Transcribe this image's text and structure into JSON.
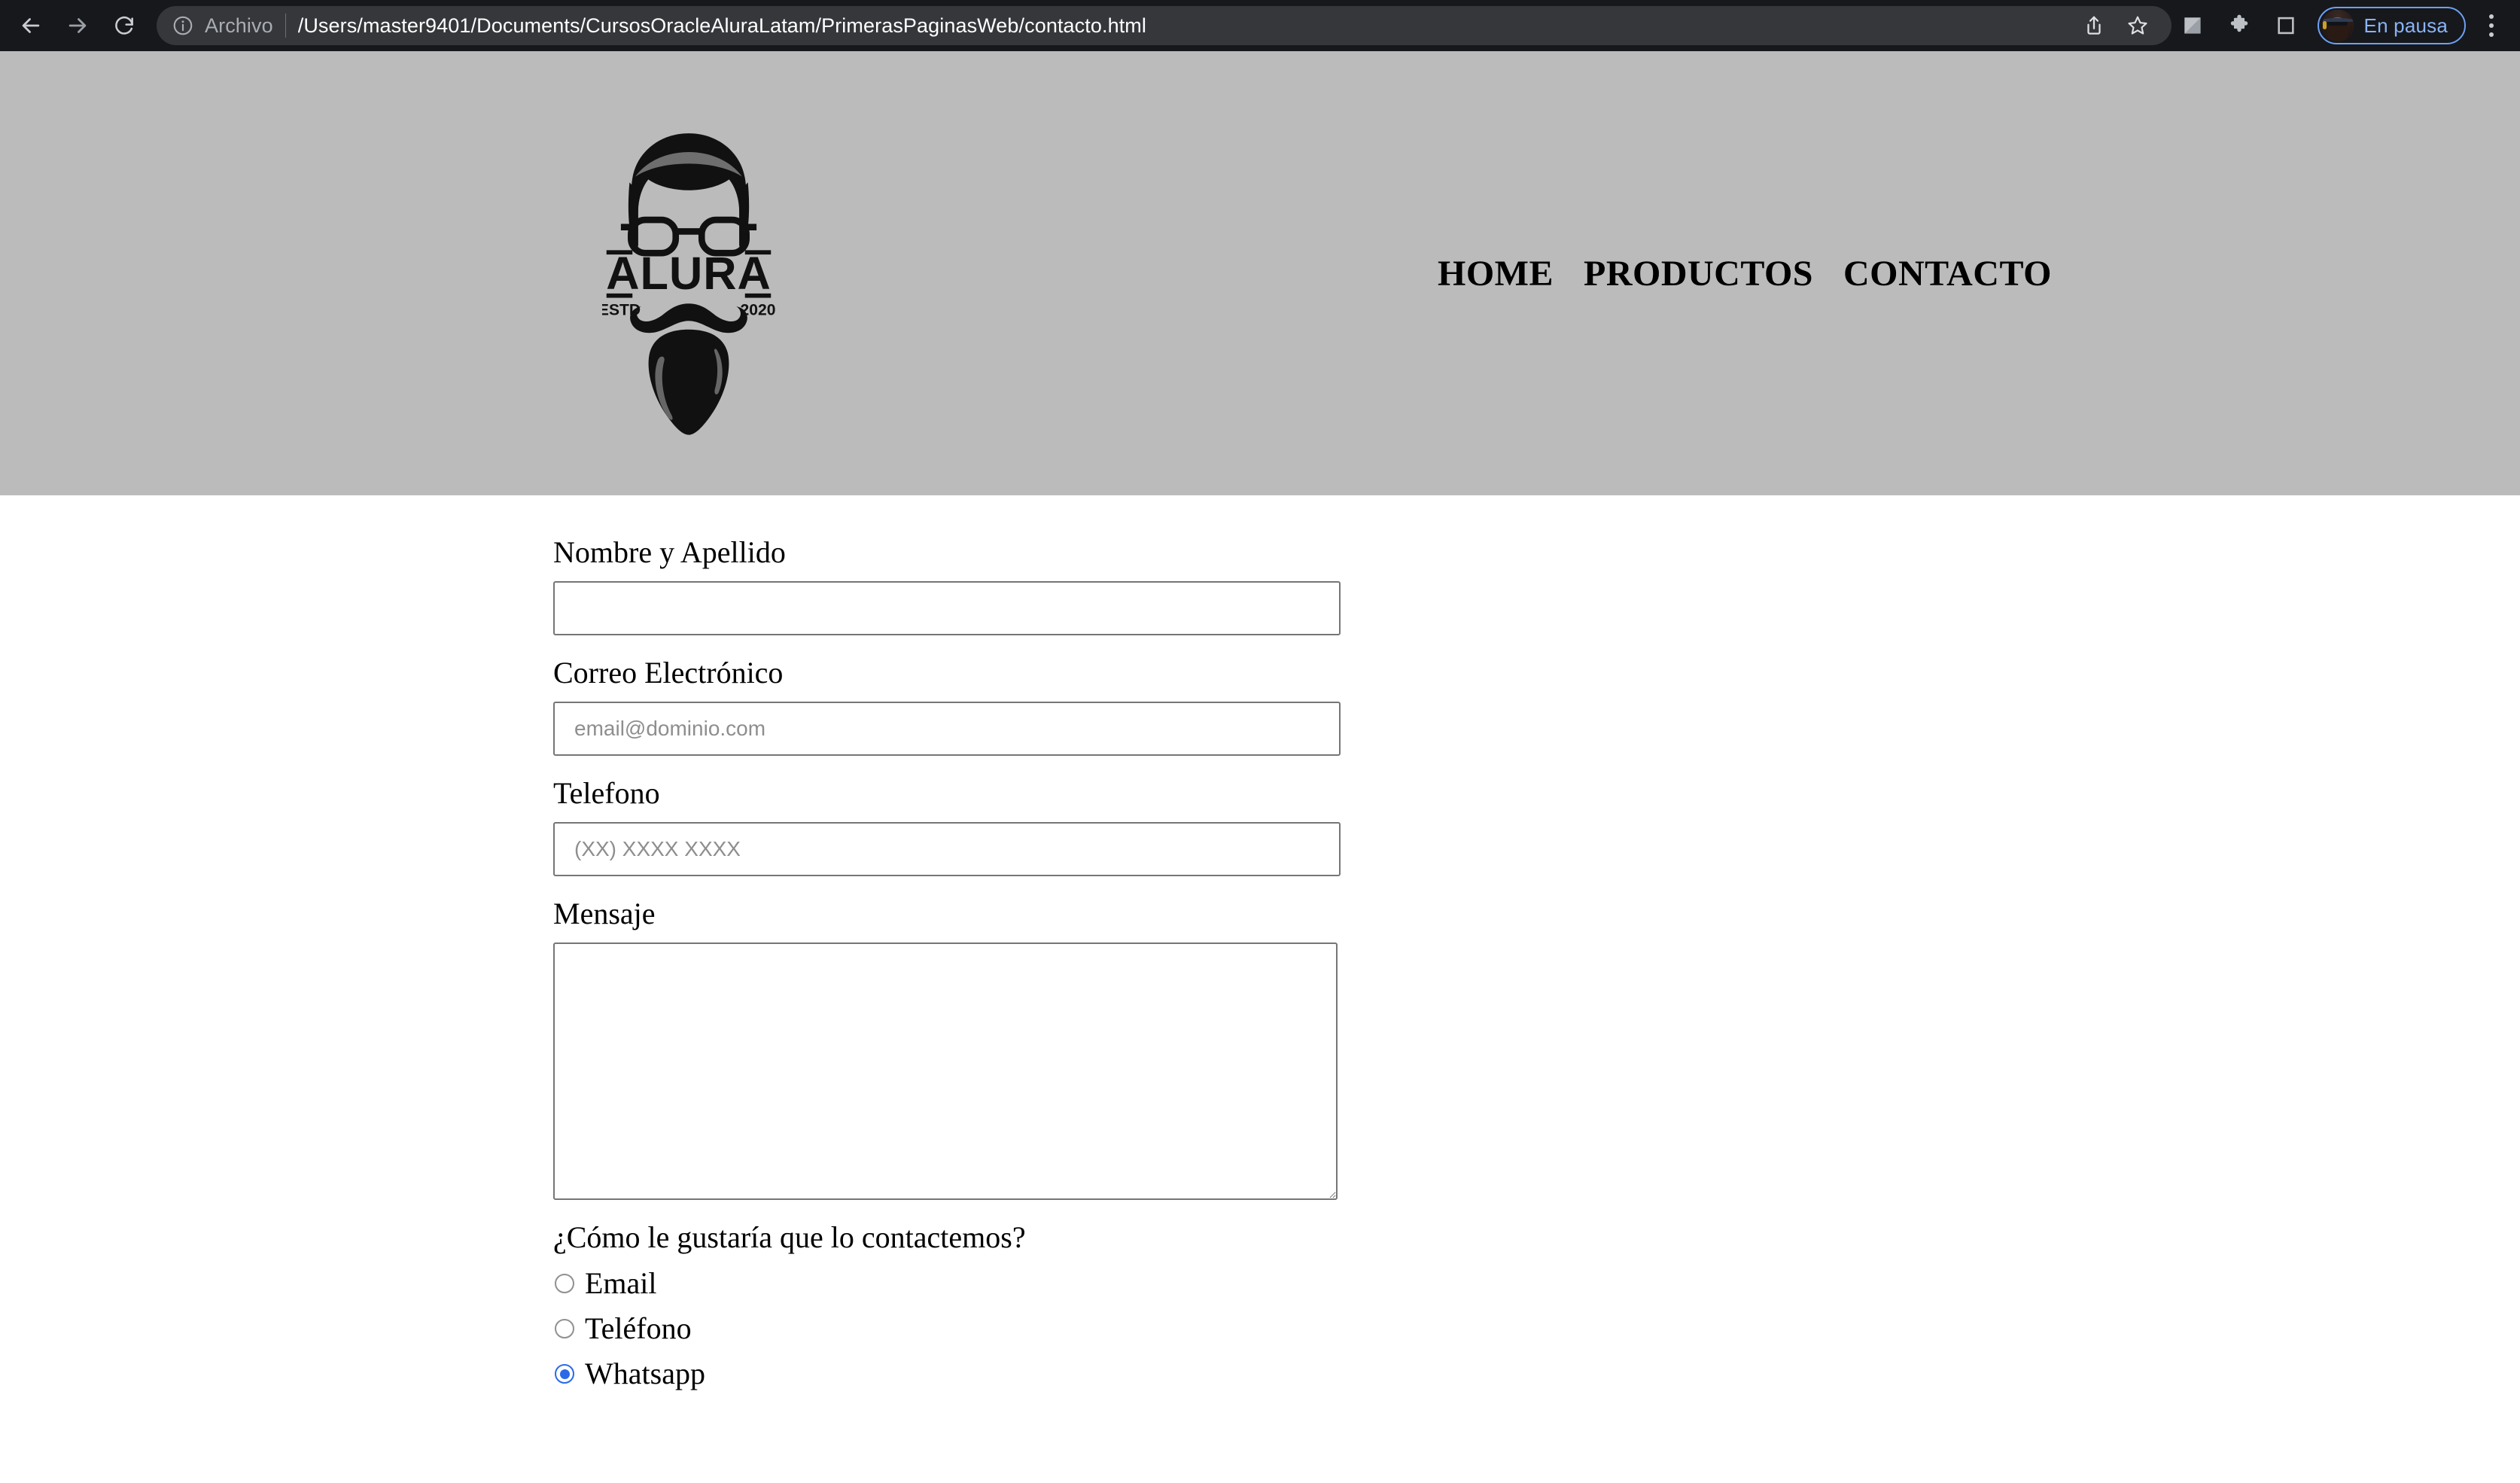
{
  "browser": {
    "back_icon": "arrow-left-icon",
    "forward_icon": "arrow-right-icon",
    "reload_icon": "reload-icon",
    "omnibox": {
      "info_icon": "info-circle-icon",
      "scheme_label": "Archivo",
      "url": "/Users/master9401/Documents/CursosOracleAluraLatam/PrimerasPaginasWeb/contacto.html",
      "share_icon": "share-icon",
      "bookmark_icon": "star-icon"
    },
    "toolbar_icons": [
      {
        "name": "split-square-icon"
      },
      {
        "name": "extensions-puzzle-icon"
      },
      {
        "name": "side-panel-icon"
      }
    ],
    "profile": {
      "avatar_name": "user-avatar",
      "status_label": "En pausa"
    },
    "menu_icon": "three-dot-menu-icon",
    "colors": {
      "chrome_bg": "#16181c",
      "omnibox_bg": "#35373b",
      "profile_accent": "#8ab4f8"
    }
  },
  "site": {
    "logo": {
      "name": "alura-barber-logo",
      "brand_text": "ALURA",
      "estd_text": "ESTD",
      "year_text": "2020"
    },
    "nav": [
      {
        "label": "HOME",
        "key": "home"
      },
      {
        "label": "PRODUCTOS",
        "key": "productos"
      },
      {
        "label": "CONTACTO",
        "key": "contacto"
      }
    ],
    "header_bg": "#bbbbbb"
  },
  "form": {
    "fields": [
      {
        "key": "nombre",
        "label": "Nombre y Apellido",
        "placeholder": "",
        "value": ""
      },
      {
        "key": "correo",
        "label": "Correo Electrónico",
        "placeholder": "email@dominio.com",
        "value": ""
      },
      {
        "key": "telefono",
        "label": "Telefono",
        "placeholder": "(XX) XXXX XXXX",
        "value": ""
      }
    ],
    "message": {
      "key": "mensaje",
      "label": "Mensaje",
      "placeholder": "",
      "value": ""
    },
    "contact_preference": {
      "question": "¿Cómo le gustaría que lo contactemos?",
      "options": [
        {
          "key": "email",
          "label": "Email",
          "selected": false
        },
        {
          "key": "telefono",
          "label": "Teléfono",
          "selected": false
        },
        {
          "key": "whatsapp",
          "label": "Whatsapp",
          "selected": true
        }
      ],
      "selected_color": "#2a6ae8"
    }
  }
}
